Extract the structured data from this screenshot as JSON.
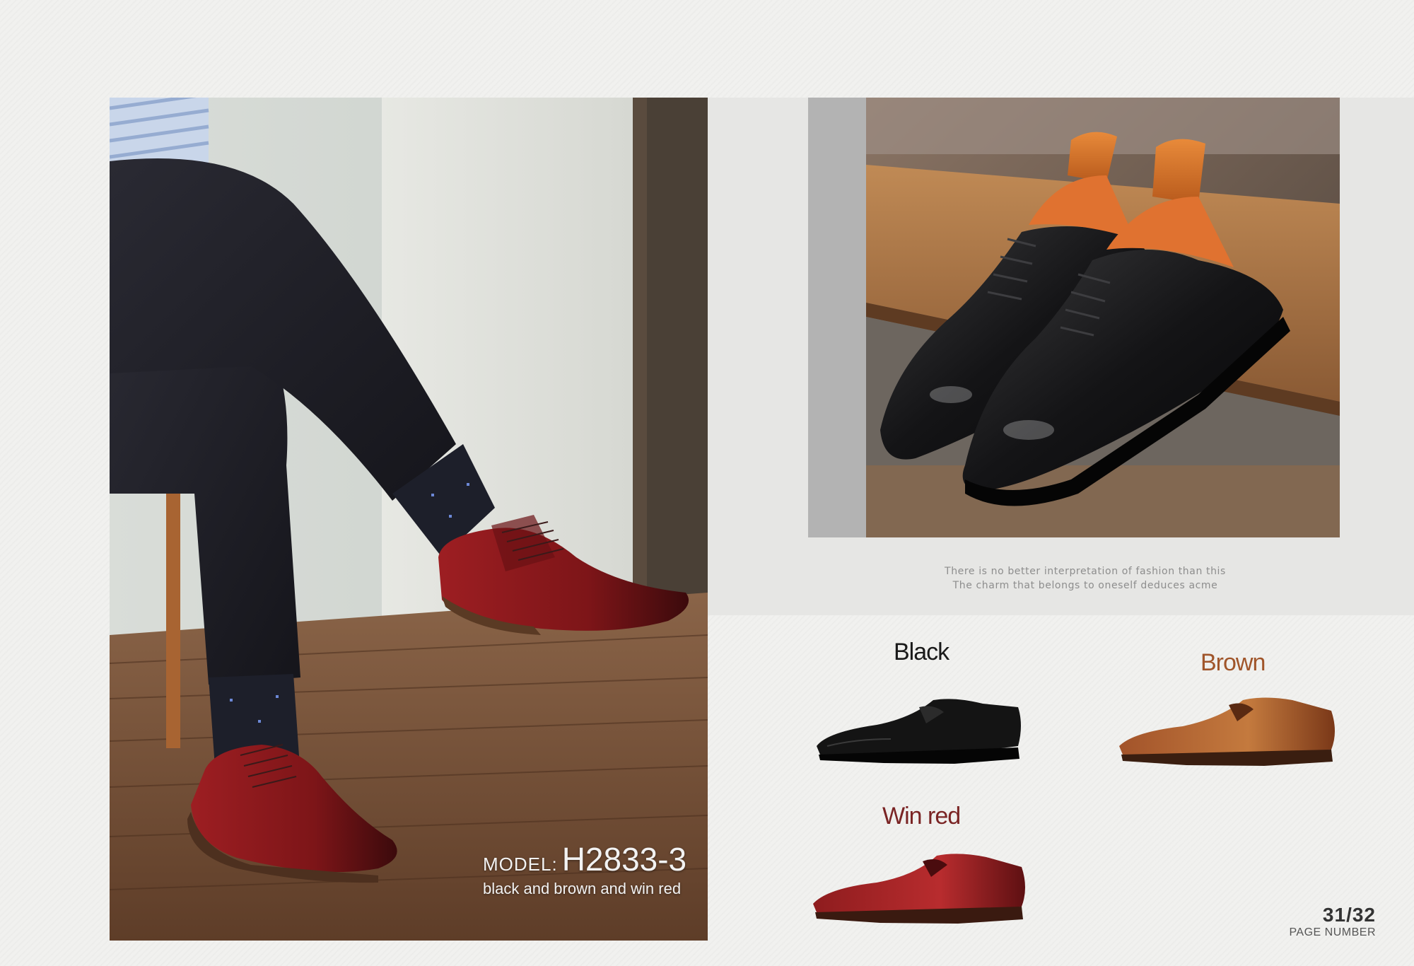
{
  "model": {
    "label": "MODEL:",
    "code": "H2833-3",
    "colors_text": "black and brown and win red"
  },
  "tagline": {
    "line1": "There is no better interpretation of fashion than this",
    "line2": "The charm that belongs to oneself deduces acme"
  },
  "variants": [
    {
      "label": "Black",
      "color": "#1a1a1a",
      "shoe_color": "#141414"
    },
    {
      "label": "Brown",
      "color": "#a0552a",
      "shoe_color": "#a8592a"
    },
    {
      "label": "Win red",
      "color": "#7a2424",
      "shoe_color": "#8e1c1e"
    }
  ],
  "page": {
    "number": "31/32",
    "label": "PAGE NUMBER"
  }
}
